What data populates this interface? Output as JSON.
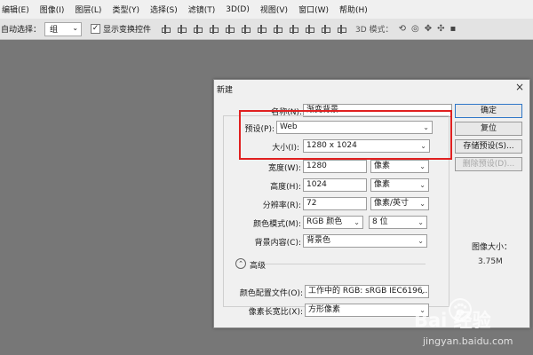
{
  "menubar": {
    "items": [
      "编辑(E)",
      "图像(I)",
      "图层(L)",
      "类型(Y)",
      "选择(S)",
      "滤镜(T)",
      "3D(D)",
      "视图(V)",
      "窗口(W)",
      "帮助(H)"
    ]
  },
  "options_bar": {
    "auto_select_label": "自动选择：",
    "auto_select_value": "组",
    "show_transform_checked": "✓",
    "show_transform_label": "显示变换控件",
    "mode_3d_label": "3D 模式："
  },
  "dialog": {
    "title": "新建",
    "close": "×",
    "name_label": "名称(N):",
    "name_value": "渐变背景",
    "preset_label": "预设(P):",
    "preset_value": "Web",
    "size_label": "大小(I):",
    "size_value": "1280 x 1024",
    "width_label": "宽度(W):",
    "width_value": "1280",
    "width_unit": "像素",
    "height_label": "高度(H):",
    "height_value": "1024",
    "height_unit": "像素",
    "resolution_label": "分辨率(R):",
    "resolution_value": "72",
    "resolution_unit": "像素/英寸",
    "color_mode_label": "颜色模式(M):",
    "color_mode_value": "RGB 颜色",
    "bit_depth_value": "8 位",
    "background_label": "背景内容(C):",
    "background_value": "背景色",
    "advanced_label": "高级",
    "color_profile_label": "颜色配置文件(O):",
    "color_profile_value": "工作中的 RGB: sRGB IEC6196...",
    "pixel_aspect_label": "像素长宽比(X):",
    "pixel_aspect_value": "方形像素",
    "buttons": {
      "ok": "确定",
      "reset": "复位",
      "save_preset": "存储预设(S)...",
      "delete_preset": "删除预设(D)..."
    },
    "image_size_label": "图像大小：",
    "image_size_value": "3.75M"
  },
  "watermark": {
    "logo_text": "Bai  经验",
    "url": "jingyan.baidu.com"
  }
}
